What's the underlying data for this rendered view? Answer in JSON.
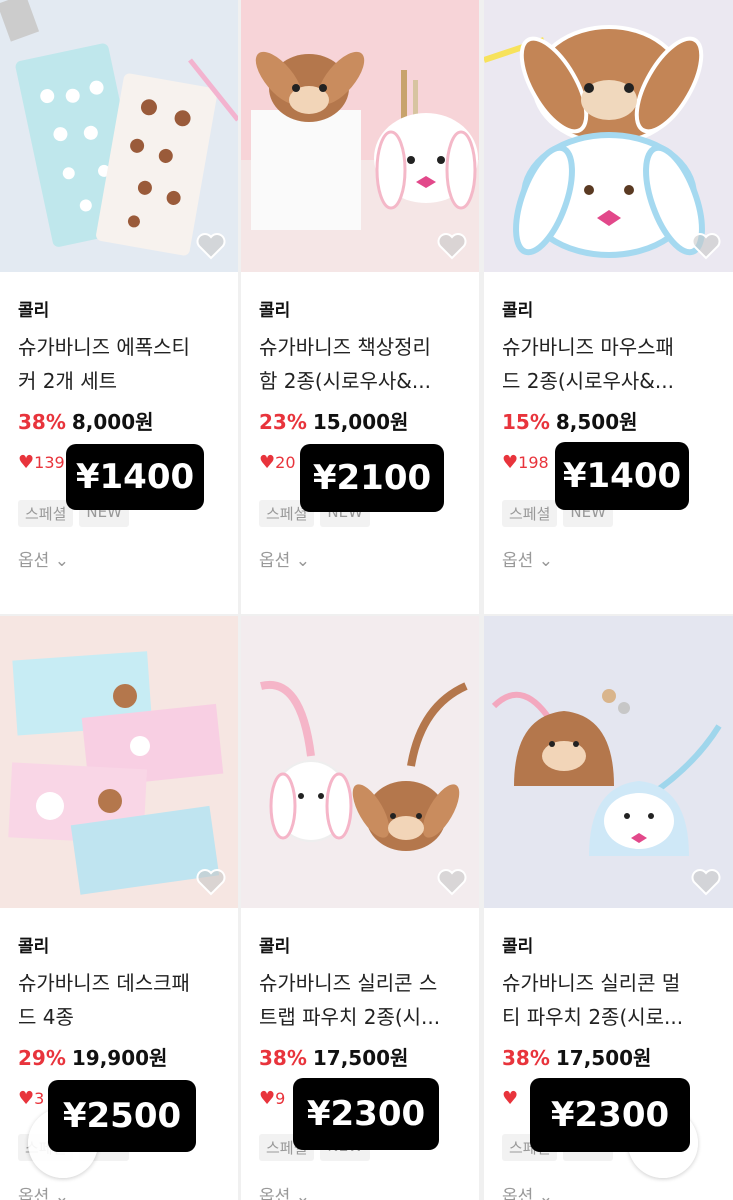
{
  "products": [
    {
      "brand": "콜리",
      "title_line1": "슈가바니즈 에폭스티",
      "title_line2": "커 2개 세트",
      "discount": "38%",
      "price": "8,000원",
      "likes": "139",
      "tags": [
        "스페셜",
        "NEW"
      ],
      "option": "옵션",
      "yen": "¥1400"
    },
    {
      "brand": "콜리",
      "title_line1": "슈가바니즈 책상정리",
      "title_line2": "함 2종(시로우사&...",
      "discount": "23%",
      "price": "15,000원",
      "likes": "20",
      "tags": [
        "스페셜",
        "NEW"
      ],
      "option": "옵션",
      "yen": "¥2100"
    },
    {
      "brand": "콜리",
      "title_line1": "슈가바니즈 마우스패",
      "title_line2": "드 2종(시로우사&...",
      "discount": "15%",
      "price": "8,500원",
      "likes": "198",
      "tags": [
        "스페셜",
        "NEW"
      ],
      "option": "옵션",
      "yen": "¥1400"
    },
    {
      "brand": "콜리",
      "title_line1": "슈가바니즈 데스크패",
      "title_line2": "드 4종",
      "discount": "29%",
      "price": "19,900원",
      "likes": "3",
      "tags": [
        "스페셜",
        "NEW"
      ],
      "option": "옵션",
      "yen": "¥2500"
    },
    {
      "brand": "콜리",
      "title_line1": "슈가바니즈 실리콘 스",
      "title_line2": "트랩 파우치 2종(시...",
      "discount": "38%",
      "price": "17,500원",
      "likes": "9",
      "tags": [
        "스페셜",
        "NEW"
      ],
      "option": "옵션",
      "yen": "¥2300"
    },
    {
      "brand": "콜리",
      "title_line1": "슈가바니즈 실리콘 멀",
      "title_line2": "티 파우치 2종(시로...",
      "discount": "38%",
      "price": "17,500원",
      "likes": "",
      "tags": [
        "스페셜",
        "NEW"
      ],
      "option": "옵션",
      "yen": "¥2300"
    }
  ],
  "icons": {
    "wishlist": "heart-outline-icon",
    "like": "heart-filled-icon",
    "chevron": "chevron-down-icon"
  },
  "colors": {
    "discount": "#e8343c",
    "badge_bg": "#000000",
    "badge_text": "#ffffff"
  }
}
